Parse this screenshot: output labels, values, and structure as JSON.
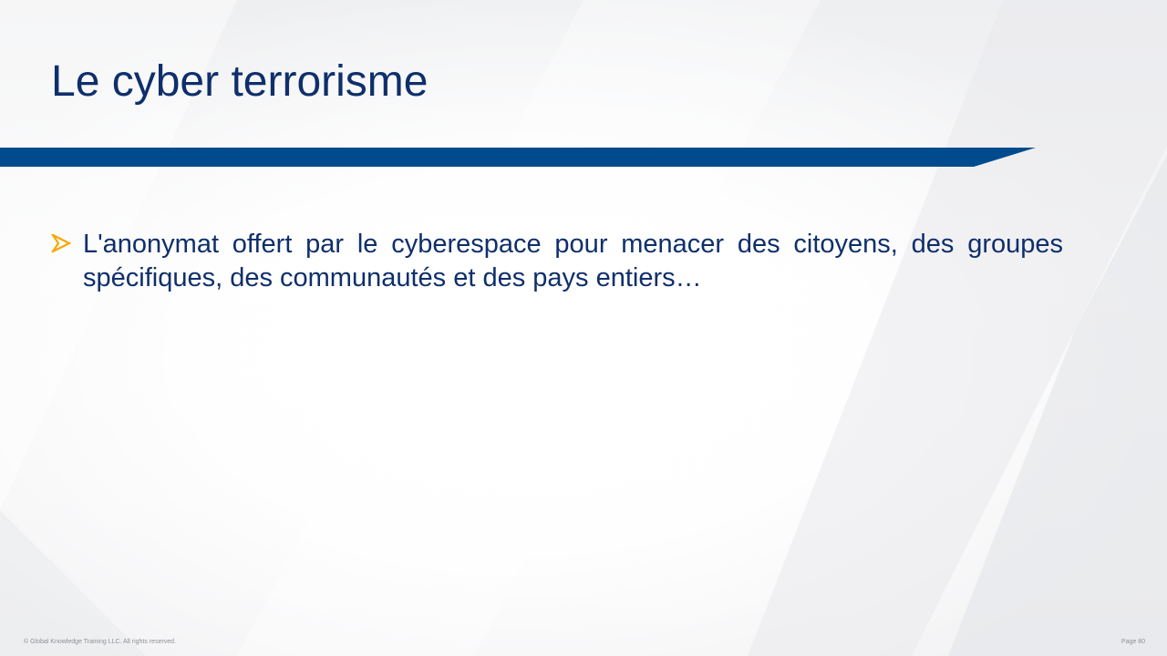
{
  "slide": {
    "title": "Le cyber terrorisme",
    "bullets": [
      {
        "icon": "arrow-bullet-icon",
        "text": "L'anonymat offert par le cyberespace pour menacer des citoyens, des groupes spécifiques, des communautés et des pays entiers…"
      }
    ]
  },
  "footer": {
    "copyright": "© Global Knowledge  Training LLC. All rights reserved.",
    "page": "Page  80"
  },
  "colors": {
    "title": "#0f2f6b",
    "band": "#004b8d",
    "bullet_arrow": "#f5a800",
    "footer_text": "#8e9096"
  }
}
